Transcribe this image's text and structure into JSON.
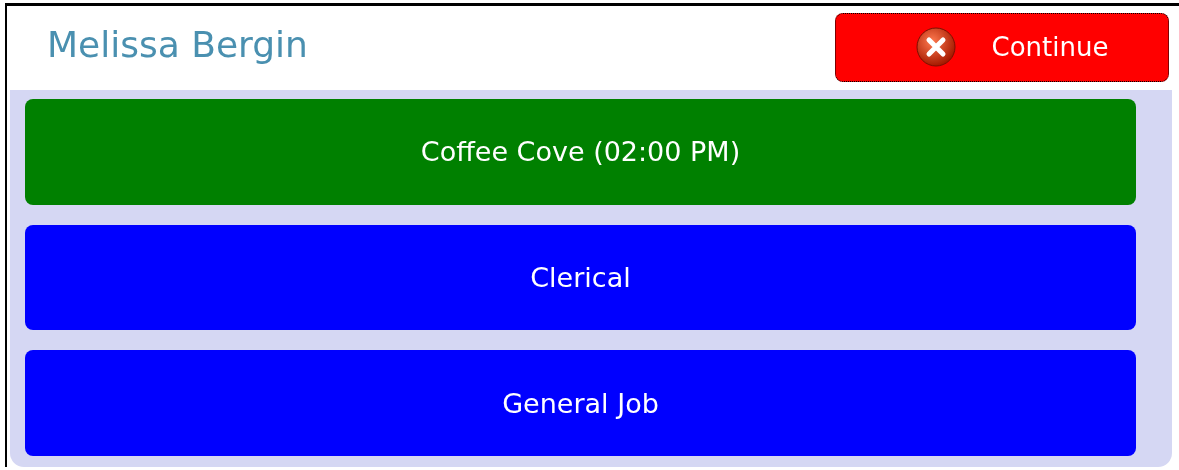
{
  "header": {
    "name": "Melissa Bergin",
    "continue_button": "Continue"
  },
  "jobs": [
    {
      "label": "Coffee Cove (02:00 PM)",
      "color": "#008000"
    },
    {
      "label": "Clerical",
      "color": "#0000ff"
    },
    {
      "label": "General Job",
      "color": "#0000ff"
    }
  ]
}
